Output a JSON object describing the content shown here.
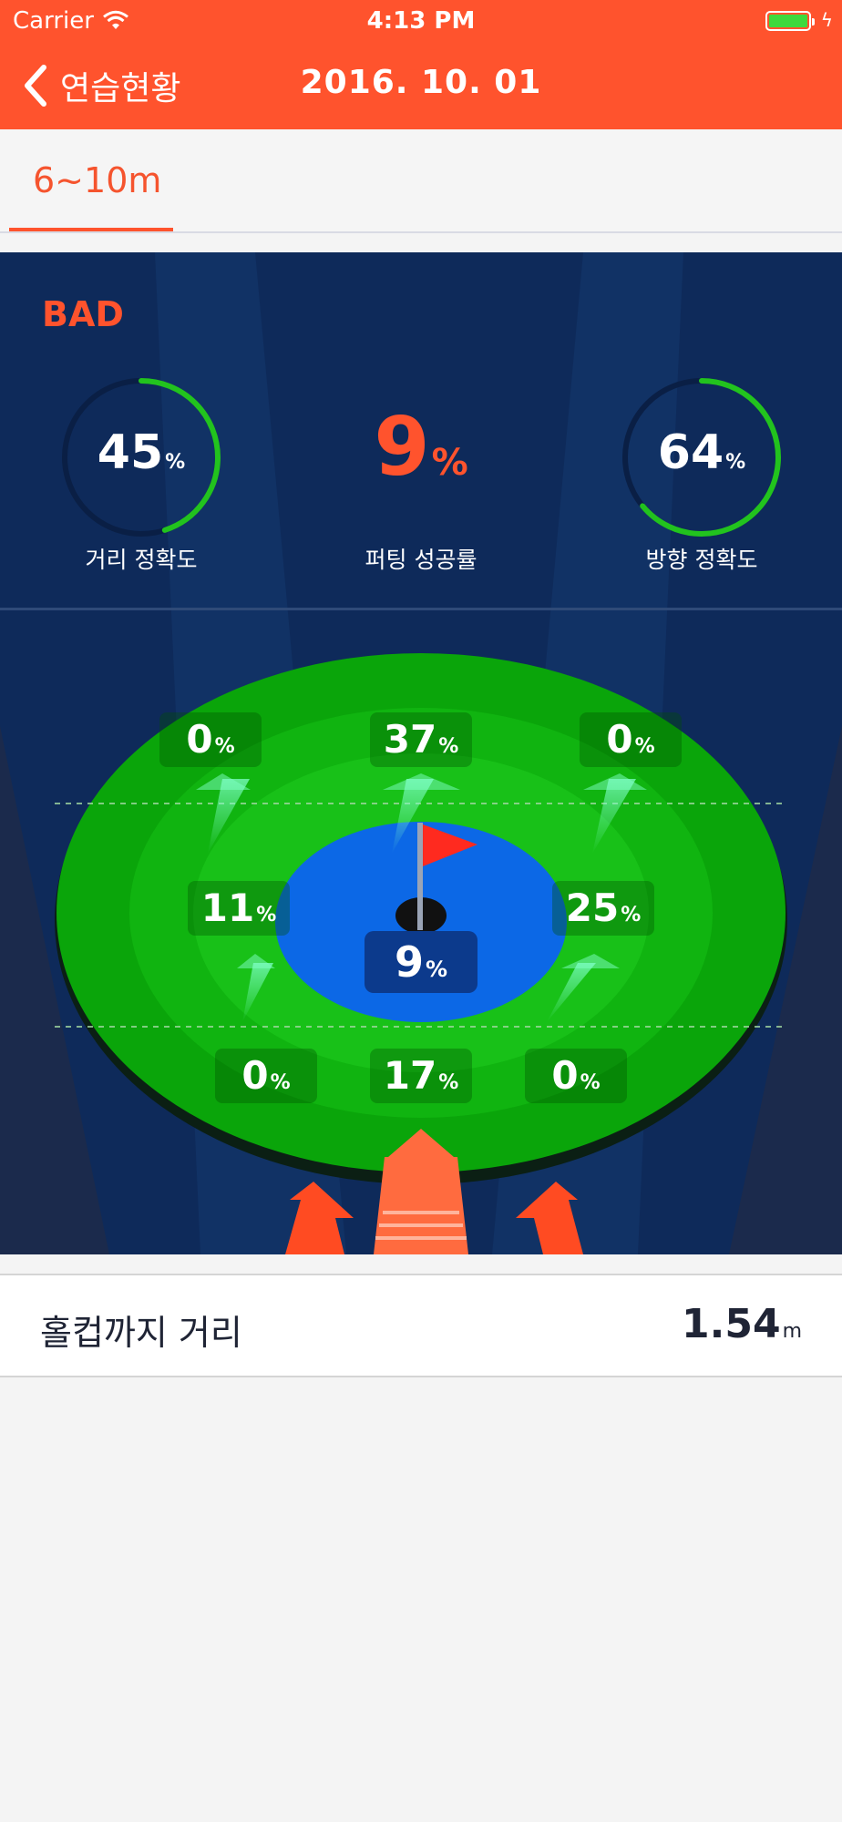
{
  "status_bar": {
    "carrier": "Carrier",
    "time": "4:13 PM",
    "battery_color": "#3dd93d"
  },
  "nav": {
    "back_label": "연습현황",
    "title": "2016. 10. 01",
    "accent_color": "#ff532d",
    "back_icon": "chevron-left-icon"
  },
  "tabs": [
    {
      "label": "6~10m",
      "selected": true
    }
  ],
  "summary": {
    "grade": "BAD",
    "distance_accuracy": {
      "value": "45",
      "unit": "%",
      "label": "거리 정확도",
      "ring_fraction": 0.45
    },
    "putting_success": {
      "value": "9",
      "unit": "%",
      "label": "퍼팅 성공률"
    },
    "direction_accuracy": {
      "value": "64",
      "unit": "%",
      "label": "방향 정확도",
      "ring_fraction": 0.64
    }
  },
  "green": {
    "zones": {
      "top_left": {
        "value": "0",
        "unit": "%"
      },
      "top_center": {
        "value": "37",
        "unit": "%"
      },
      "top_right": {
        "value": "0",
        "unit": "%"
      },
      "mid_left": {
        "value": "11",
        "unit": "%"
      },
      "center": {
        "value": "9",
        "unit": "%"
      },
      "mid_right": {
        "value": "25",
        "unit": "%"
      },
      "bottom_left": {
        "value": "0",
        "unit": "%"
      },
      "bottom_center": {
        "value": "17",
        "unit": "%"
      },
      "bottom_right": {
        "value": "0",
        "unit": "%"
      }
    },
    "flag_icon": "flag-icon",
    "hole_icon": "hole-cup-icon"
  },
  "distance_to_cup": {
    "label": "홀컵까지 거리",
    "value": "1.54",
    "unit": "m"
  }
}
